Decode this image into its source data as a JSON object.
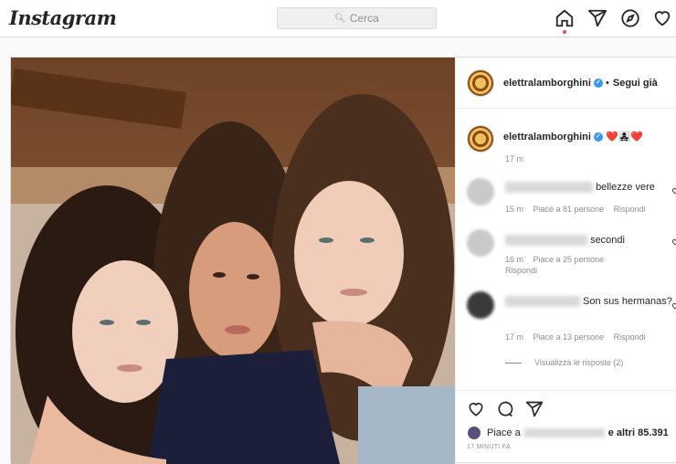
{
  "topbar": {
    "logo": "Instagram",
    "search_placeholder": "Cerca",
    "icons": [
      "home-icon",
      "direct-icon",
      "explore-icon",
      "activity-icon"
    ]
  },
  "post": {
    "author": "elettralamborghini",
    "follow_status": "Segui già",
    "caption_emojis": "❤️👩‍👧‍👧❤️",
    "caption_time": "17 m",
    "comments": [
      {
        "text": "bellezze vere",
        "time": "15 m",
        "likes": "Piace a 81 persone",
        "reply": "Rispondi"
      },
      {
        "text": "secondi",
        "time": "16 m",
        "likes": "Piace a 25 persone",
        "reply": "Rispondi"
      },
      {
        "text": "Son sus hermanas?",
        "time": "17 m",
        "likes": "Piace a 13 persone",
        "reply": "Rispondi"
      }
    ],
    "view_replies": "Visualizza le risposte (2)",
    "liked_by_prefix": "Piace a",
    "liked_by_suffix": "e altri 85.391",
    "posted_ago": "17 MINUTI FA"
  },
  "colors": {
    "accent": "#3897f0",
    "notification": "#ed4956",
    "heart": "#ed4956"
  }
}
